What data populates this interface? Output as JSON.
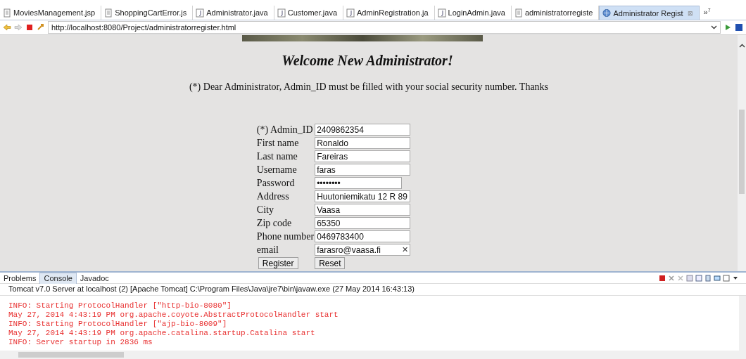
{
  "editor_tabs": [
    {
      "label": "MoviesManagement.jsp",
      "kind": "file",
      "selected": false
    },
    {
      "label": "ShoppingCartError.js",
      "kind": "file",
      "selected": false
    },
    {
      "label": "Administrator.java",
      "kind": "java",
      "selected": false
    },
    {
      "label": "Customer.java",
      "kind": "java",
      "selected": false
    },
    {
      "label": "AdminRegistration.ja",
      "kind": "java",
      "selected": false
    },
    {
      "label": "LoginAdmin.java",
      "kind": "java",
      "selected": false
    },
    {
      "label": "administratorregiste",
      "kind": "file",
      "selected": false
    },
    {
      "label": "Administrator Regist",
      "kind": "web",
      "selected": true
    }
  ],
  "tab_close": "⊠",
  "overflow_tabs": "»",
  "overflow_count": "7",
  "url": "http://localhost:8080/Project/administratorregister.html",
  "page": {
    "heading": "Welcome New Administrator!",
    "notice": "(*) Dear Administrator, Admin_ID must be filled with your social security number. Thanks",
    "fields": [
      {
        "label": "(*) Admin_ID",
        "value": "2409862354",
        "kind": "text"
      },
      {
        "label": "First name",
        "value": "Ronaldo",
        "kind": "text"
      },
      {
        "label": "Last name",
        "value": "Fareiras",
        "kind": "text"
      },
      {
        "label": "Username",
        "value": "faras",
        "kind": "text"
      },
      {
        "label": "Password",
        "value": "••••••••",
        "kind": "password"
      },
      {
        "label": "Address",
        "value": "Huutoniemikatu 12 R 89",
        "kind": "text"
      },
      {
        "label": "City",
        "value": "Vaasa",
        "kind": "text"
      },
      {
        "label": "Zip code",
        "value": "65350",
        "kind": "text"
      },
      {
        "label": "Phone number",
        "value": "0469783400",
        "kind": "text"
      },
      {
        "label": "email",
        "value": "farasro@vaasa.fi",
        "kind": "search",
        "clear": "✕"
      }
    ],
    "buttons": [
      "Register",
      "Reset"
    ]
  },
  "console": {
    "tabs": [
      {
        "label": "Problems",
        "selected": false
      },
      {
        "label": "Console",
        "selected": true
      },
      {
        "label": "Javadoc",
        "selected": false
      }
    ],
    "server": "Tomcat v7.0 Server at localhost (2) [Apache Tomcat] C:\\Program Files\\Java\\jre7\\bin\\javaw.exe (27 May 2014 16:43:13)",
    "lines": [
      "INFO: Starting ProtocolHandler [\"http-bio-8080\"]",
      "May 27, 2014 4:43:19 PM org.apache.coyote.AbstractProtocolHandler start",
      "INFO: Starting ProtocolHandler [\"ajp-bio-8009\"]",
      "May 27, 2014 4:43:19 PM org.apache.catalina.startup.Catalina start",
      "INFO: Server startup in 2836 ms"
    ]
  }
}
